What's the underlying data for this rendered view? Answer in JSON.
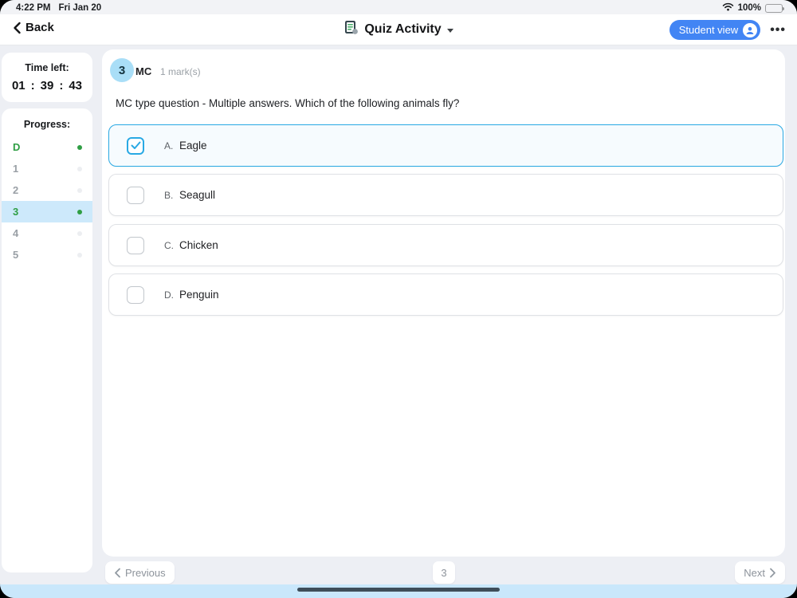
{
  "status_bar": {
    "time": "4:22 PM",
    "date": "Fri Jan 20",
    "battery_percent": "100%"
  },
  "header": {
    "back_label": "Back",
    "title": "Quiz Activity",
    "student_view_label": "Student view",
    "menu_label": "•••"
  },
  "sidebar": {
    "timer": {
      "label": "Time left:",
      "parts": [
        "01",
        "39",
        "43"
      ],
      "colon": ":"
    },
    "progress": {
      "label": "Progress:",
      "items": [
        {
          "label": "D",
          "state": "answered",
          "active": false
        },
        {
          "label": "1",
          "state": "unanswered",
          "active": false
        },
        {
          "label": "2",
          "state": "unanswered",
          "active": false
        },
        {
          "label": "3",
          "state": "answered",
          "active": true
        },
        {
          "label": "4",
          "state": "unanswered",
          "active": false
        },
        {
          "label": "5",
          "state": "unanswered",
          "active": false
        }
      ]
    }
  },
  "question": {
    "number": "3",
    "type": "MC",
    "marks": "1 mark(s)",
    "text": "MC type question - Multiple answers. Which of the following animals fly?",
    "options": [
      {
        "letter": "A.",
        "text": "Eagle",
        "checked": true
      },
      {
        "letter": "B.",
        "text": "Seagull",
        "checked": false
      },
      {
        "letter": "C.",
        "text": "Chicken",
        "checked": false
      },
      {
        "letter": "D.",
        "text": "Penguin",
        "checked": false
      }
    ]
  },
  "pagination": {
    "previous_label": "Previous",
    "page": "3",
    "next_label": "Next"
  },
  "colors": {
    "page_bg": "#edeff4",
    "accent_blue": "#29a9e4",
    "selected_bg": "#f6fbfe",
    "progress_green": "#2f9e44",
    "active_row_bg": "#cde9fb",
    "student_view_blue": "#4285f4",
    "question_badge_bg": "#a9def7",
    "bottom_strip": "#c9e7fb"
  }
}
